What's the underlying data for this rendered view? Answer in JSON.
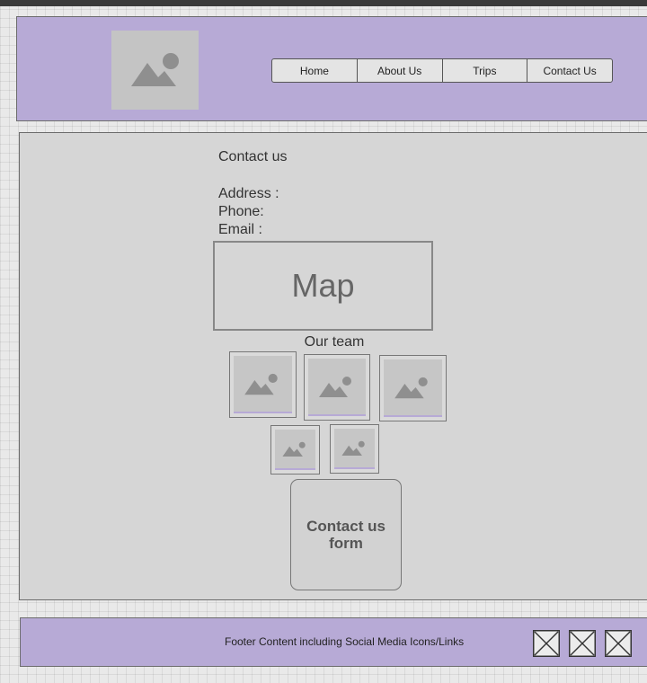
{
  "header": {
    "logo_icon": "image-placeholder-icon",
    "nav": [
      "Home",
      "About Us",
      "Trips",
      "Contact Us"
    ]
  },
  "contact": {
    "title": "Contact us",
    "address_label": "Address :",
    "phone_label": "Phone:",
    "email_label": "Email :"
  },
  "map": {
    "label": "Map"
  },
  "team": {
    "title": "Our team",
    "photo_icon": "image-placeholder-icon"
  },
  "form": {
    "label": "Contact us form"
  },
  "footer": {
    "text": "Footer Content including Social Media Icons/Links",
    "social_icons": [
      "placeholder-x-icon",
      "placeholder-x-icon",
      "placeholder-x-icon"
    ]
  },
  "colors": {
    "header_bg": "#b7aad6",
    "content_bg": "#d6d6d6",
    "placeholder_bg": "#c4c4c4"
  }
}
